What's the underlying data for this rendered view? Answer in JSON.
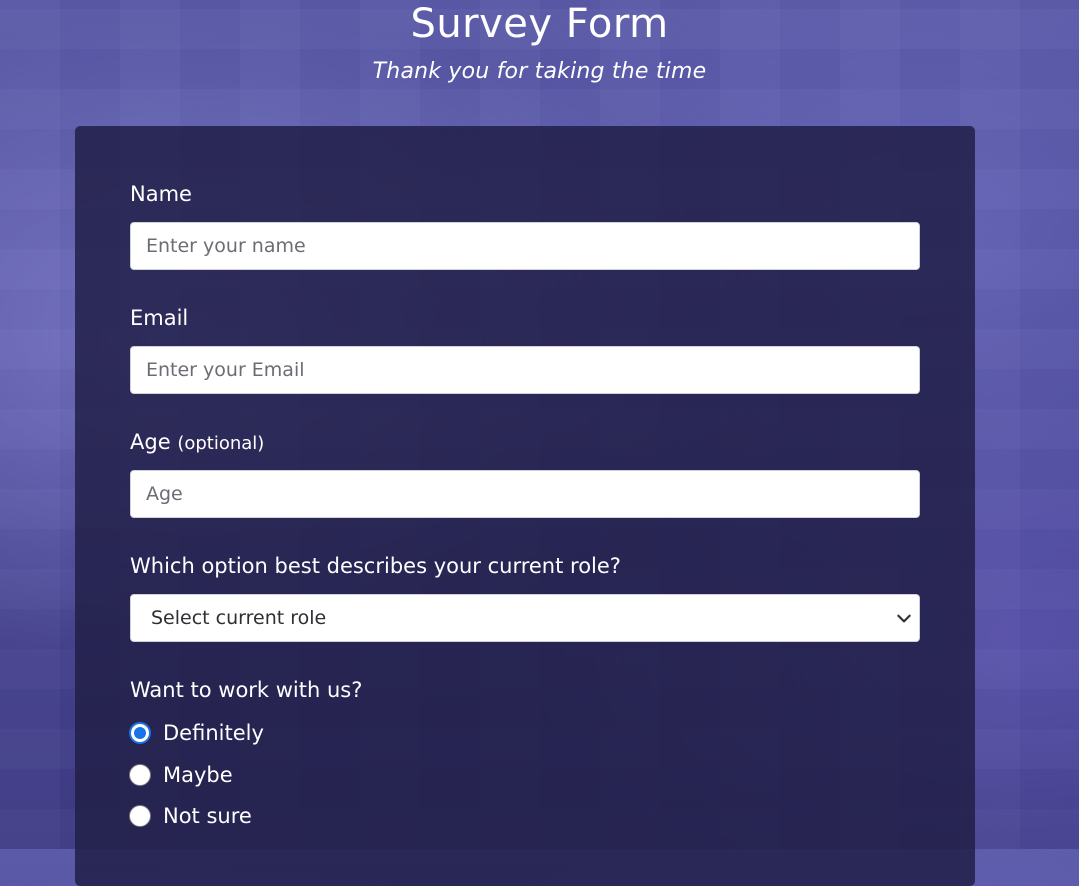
{
  "header": {
    "title": "Survey Form",
    "subtitle": "Thank you for taking the time"
  },
  "form": {
    "name": {
      "label": "Name",
      "placeholder": "Enter your name",
      "value": ""
    },
    "email": {
      "label": "Email",
      "placeholder": "Enter your Email",
      "value": ""
    },
    "age": {
      "label": "Age",
      "optional": "(optional)",
      "placeholder": "Age",
      "value": ""
    },
    "role": {
      "label": "Which option best describes your current role?",
      "selected": "Select current role"
    },
    "work_with_us": {
      "label": "Want to work with us?",
      "options": [
        {
          "label": "Definitely",
          "checked": true
        },
        {
          "label": "Maybe",
          "checked": false
        },
        {
          "label": "Not sure",
          "checked": false
        }
      ]
    }
  },
  "colors": {
    "background": "#4e4b9a",
    "panel": "#222048",
    "accent": "#1a73e8"
  },
  "icons": [
    "chevron-down-icon"
  ]
}
